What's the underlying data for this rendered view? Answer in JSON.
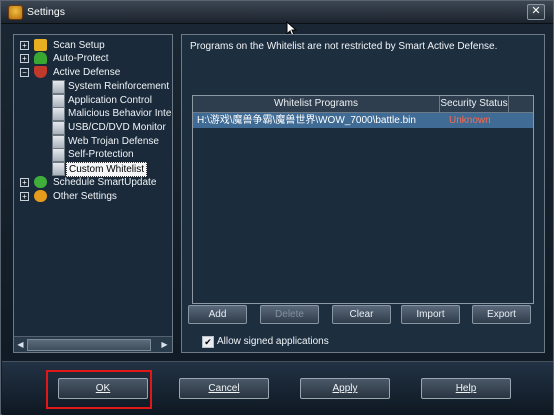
{
  "window": {
    "title": "Settings"
  },
  "tree": {
    "items": [
      {
        "label": "Scan Setup",
        "expander": "+",
        "icon": "scan-icon",
        "color": "#e8b020"
      },
      {
        "label": "Auto-Protect",
        "expander": "+",
        "icon": "umbrella-icon",
        "color": "#39a832"
      },
      {
        "label": "Active Defense",
        "expander": "−",
        "icon": "shield-icon",
        "color": "#c0392b"
      },
      {
        "label": "System Reinforcement",
        "icon": "page-icon"
      },
      {
        "label": "Application Control",
        "icon": "page-icon"
      },
      {
        "label": "Malicious Behavior Interc",
        "icon": "page-icon"
      },
      {
        "label": "USB/CD/DVD Monitor",
        "icon": "page-icon"
      },
      {
        "label": "Web Trojan Defense",
        "icon": "page-icon"
      },
      {
        "label": "Self-Protection",
        "icon": "page-icon"
      },
      {
        "label": "Custom Whitelist",
        "icon": "page-icon",
        "selected": true
      },
      {
        "label": "Schedule SmartUpdate",
        "expander": "+",
        "icon": "update-icon",
        "color": "#3fae3a"
      },
      {
        "label": "Other Settings",
        "expander": "+",
        "icon": "gear-icon",
        "color": "#e59b1b"
      }
    ],
    "scroll_left": "◀",
    "scroll_right": "▶"
  },
  "panel": {
    "description": "Programs on the Whitelist are not restricted by Smart Active Defense.",
    "columns": [
      "Whitelist Programs",
      "Security Status"
    ],
    "rows": [
      {
        "program": "H:\\游戏\\魔兽争霸\\魔兽世界\\WOW_7000\\battle.bin",
        "status": "Unknown"
      }
    ],
    "status_color": "#ff6a4a",
    "buttons": {
      "add": "Add",
      "delete": "Delete",
      "clear": "Clear",
      "import": "Import",
      "export": "Export"
    },
    "allow_signed": {
      "label": "Allow signed applications",
      "checked": "✔"
    }
  },
  "footer": {
    "ok": "OK",
    "cancel": "Cancel",
    "apply": "Apply",
    "help": "Help"
  },
  "close_glyph": "✕"
}
